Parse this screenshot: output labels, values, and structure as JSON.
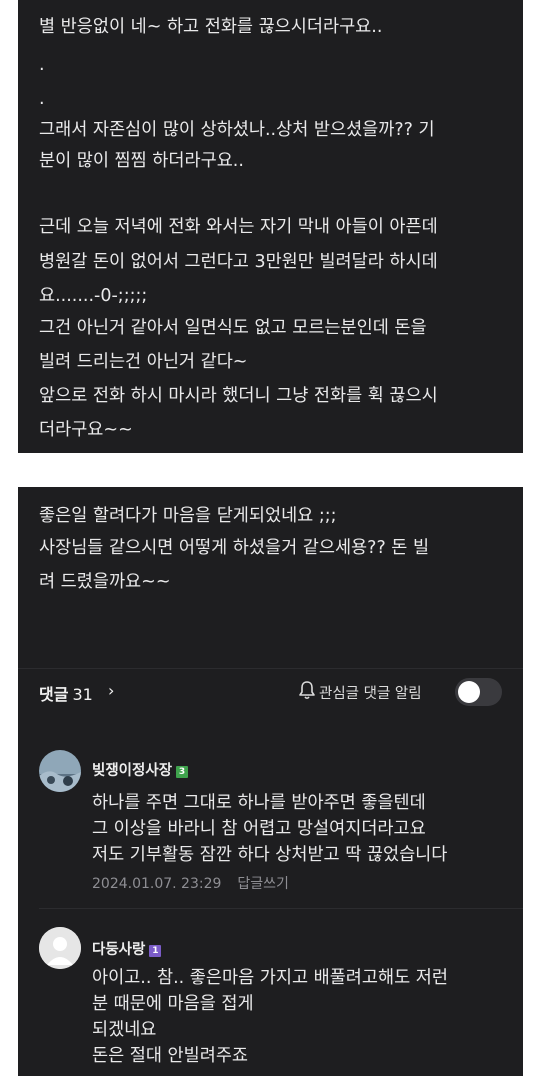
{
  "post_part1": {
    "lines": [
      "별 반응없이 네~ 하고 전화를 끊으시더라구요..",
      ".",
      ".",
      "그래서 자존심이 많이 상하셨나..상처 받으셨을까?? 기",
      "분이 많이 찜찜 하더라구요..",
      "근데 오늘 저녁에 전화 와서는 자기 막내 아들이 아픈데",
      "병원갈 돈이 없어서 그런다고 3만원만 빌려달라 하시데",
      "요.......-0-;;;;;",
      "그건 아닌거 같아서 일면식도 없고 모르는분인데 돈을",
      "빌려 드리는건 아닌거 같다~",
      "앞으로 전화 하시 마시라 했더니 그냥 전화를 휙 끊으시",
      "더라구요~~"
    ]
  },
  "post_part2": {
    "lines": [
      "좋은일 할려다가 마음을 닫게되었네요 ;;;",
      "사장님들 같으시면 어떻게 하셨을거 같으세용?? 돈 빌",
      "려 드렸을까요~~"
    ]
  },
  "comments_bar": {
    "label": "댓글",
    "count": "31",
    "chevron": "›",
    "notify_label": "관심글 댓글 알림",
    "notify_on": false
  },
  "comments": [
    {
      "author": "빚쟁이정사장",
      "grade": "3",
      "grade_color": "#3fa34d",
      "lines": [
        "하나를 주면 그대로 하나를 받아주면 좋을텐데",
        "그 이상을 바라니 참 어렵고 망설여지더라고요",
        "저도 기부활동 잠깐 하다 상처받고 딱 끊었습니다"
      ],
      "date": "2024.01.07. 23:29",
      "reply_label": "답글쓰기"
    },
    {
      "author": "다둥사랑",
      "grade": "1",
      "grade_color": "#7b5cc8",
      "lines": [
        "아이고.. 참.. 좋은마음 가지고 배풀려고해도 저런",
        "분 때문에 마음을 접게",
        "되겠네요",
        "돈은 절대 안빌려주죠"
      ]
    }
  ],
  "colors": {
    "panel_bg": "#1e1e20",
    "text": "#e9e9ea",
    "meta": "#8e8e93"
  }
}
